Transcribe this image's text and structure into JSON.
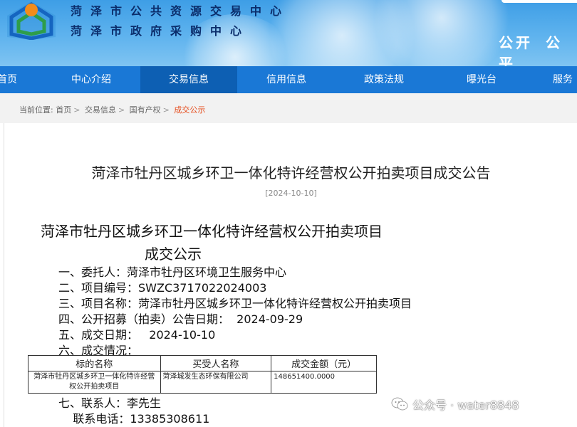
{
  "header": {
    "org_line1": "菏泽市公共资源交易中心",
    "org_line2": "菏泽市政府采购中心",
    "slogan": [
      "公开",
      "公平"
    ]
  },
  "nav": {
    "items": [
      {
        "label": "首页"
      },
      {
        "label": "中心介绍"
      },
      {
        "label": "交易信息",
        "active": true
      },
      {
        "label": "信用信息"
      },
      {
        "label": "政策法规"
      },
      {
        "label": "曝光台"
      },
      {
        "label": "服务"
      }
    ]
  },
  "breadcrumb": {
    "prefix": "当前位置:",
    "items": [
      "首页",
      "交易信息",
      "国有产权"
    ],
    "current": "成交公示"
  },
  "article": {
    "title": "菏泽市牡丹区城乡环卫一体化特许经营权公开拍卖项目成交公告",
    "date": "[2024-10-10]",
    "doc_title_line1": "菏泽市牡丹区城乡环卫一体化特许经营权公开拍卖项目",
    "doc_title_line2": "成交公示",
    "lines": [
      "一、委托人：菏泽市牡丹区环境卫生服务中心",
      "二、项目编号：SWZC3717022024003",
      "三、项目名称：菏泽市牡丹区城乡环卫一体化特许经营权公开拍卖项目",
      "四、公开招募（拍卖）公告日期：  2024-09-29",
      "五、成交日期：   2024-10-10",
      "六、成交情况：",
      "七、联系人：李先生",
      "    联系电话：13385308611"
    ],
    "table": {
      "headers": [
        "标的名称",
        "买受人名称",
        "成交金额（元）"
      ],
      "rows": [
        [
          "菏泽市牡丹区城乡环卫一体化特许经营权公开拍卖项目",
          "菏泽城发生态环保有限公司",
          "148651400.0000"
        ]
      ]
    }
  },
  "watermark": {
    "text": "公众号 · water8848"
  },
  "colors": {
    "nav_bg": "#1a78d6",
    "nav_active": "#0d5fb3",
    "header_bg": "#4aa6ea",
    "breadcrumb_current": "#e64a19"
  }
}
